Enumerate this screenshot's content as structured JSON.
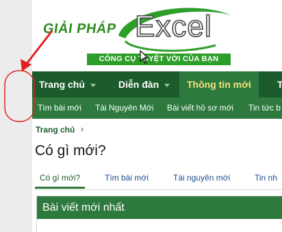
{
  "logo": {
    "giai_phap": "GIẢI PHÁP",
    "excel": "Excel",
    "tagline": "CÔNG CỤ TUYỆT VỜI CỦA BẠN"
  },
  "nav": {
    "items": [
      "Trang chủ",
      "Diễn đàn",
      "Thông tin mới",
      "T"
    ]
  },
  "subnav": {
    "items": [
      "Tìm bài mới",
      "Tài Nguyên Mới",
      "Bài viết hồ sơ mới",
      "Tin tức b"
    ]
  },
  "breadcrumb": {
    "home": "Trang chủ",
    "separator": "›"
  },
  "page_title": "Có gì mới?",
  "tabs": [
    "Có gì mới?",
    "Tìm bài mới",
    "Tài nguyên mới",
    "Tin nh"
  ],
  "latest_block": {
    "title": "Bài viết mới nhất"
  },
  "colors": {
    "nav_bg": "#1c5c2c",
    "subnav_bg": "#2e7a3e",
    "active_text": "#f4e27a",
    "annotation_red": "#e02020",
    "logo_green": "#2e8b1e"
  }
}
